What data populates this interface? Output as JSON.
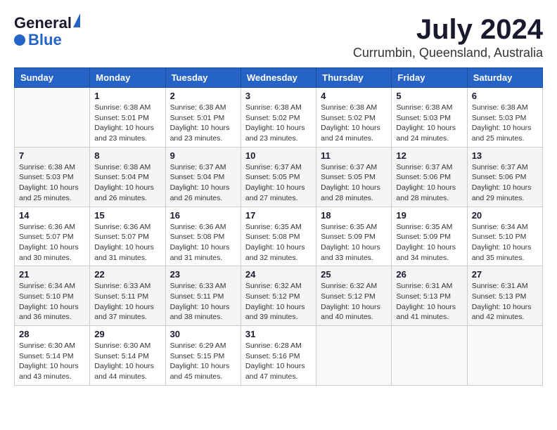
{
  "header": {
    "logo_line1": "General",
    "logo_line2": "Blue",
    "main_title": "July 2024",
    "subtitle": "Currumbin, Queensland, Australia"
  },
  "calendar": {
    "days_of_week": [
      "Sunday",
      "Monday",
      "Tuesday",
      "Wednesday",
      "Thursday",
      "Friday",
      "Saturday"
    ],
    "weeks": [
      [
        {
          "day": "",
          "info": ""
        },
        {
          "day": "1",
          "info": "Sunrise: 6:38 AM\nSunset: 5:01 PM\nDaylight: 10 hours\nand 23 minutes."
        },
        {
          "day": "2",
          "info": "Sunrise: 6:38 AM\nSunset: 5:01 PM\nDaylight: 10 hours\nand 23 minutes."
        },
        {
          "day": "3",
          "info": "Sunrise: 6:38 AM\nSunset: 5:02 PM\nDaylight: 10 hours\nand 23 minutes."
        },
        {
          "day": "4",
          "info": "Sunrise: 6:38 AM\nSunset: 5:02 PM\nDaylight: 10 hours\nand 24 minutes."
        },
        {
          "day": "5",
          "info": "Sunrise: 6:38 AM\nSunset: 5:03 PM\nDaylight: 10 hours\nand 24 minutes."
        },
        {
          "day": "6",
          "info": "Sunrise: 6:38 AM\nSunset: 5:03 PM\nDaylight: 10 hours\nand 25 minutes."
        }
      ],
      [
        {
          "day": "7",
          "info": "Sunrise: 6:38 AM\nSunset: 5:03 PM\nDaylight: 10 hours\nand 25 minutes."
        },
        {
          "day": "8",
          "info": "Sunrise: 6:38 AM\nSunset: 5:04 PM\nDaylight: 10 hours\nand 26 minutes."
        },
        {
          "day": "9",
          "info": "Sunrise: 6:37 AM\nSunset: 5:04 PM\nDaylight: 10 hours\nand 26 minutes."
        },
        {
          "day": "10",
          "info": "Sunrise: 6:37 AM\nSunset: 5:05 PM\nDaylight: 10 hours\nand 27 minutes."
        },
        {
          "day": "11",
          "info": "Sunrise: 6:37 AM\nSunset: 5:05 PM\nDaylight: 10 hours\nand 28 minutes."
        },
        {
          "day": "12",
          "info": "Sunrise: 6:37 AM\nSunset: 5:06 PM\nDaylight: 10 hours\nand 28 minutes."
        },
        {
          "day": "13",
          "info": "Sunrise: 6:37 AM\nSunset: 5:06 PM\nDaylight: 10 hours\nand 29 minutes."
        }
      ],
      [
        {
          "day": "14",
          "info": "Sunrise: 6:36 AM\nSunset: 5:07 PM\nDaylight: 10 hours\nand 30 minutes."
        },
        {
          "day": "15",
          "info": "Sunrise: 6:36 AM\nSunset: 5:07 PM\nDaylight: 10 hours\nand 31 minutes."
        },
        {
          "day": "16",
          "info": "Sunrise: 6:36 AM\nSunset: 5:08 PM\nDaylight: 10 hours\nand 31 minutes."
        },
        {
          "day": "17",
          "info": "Sunrise: 6:35 AM\nSunset: 5:08 PM\nDaylight: 10 hours\nand 32 minutes."
        },
        {
          "day": "18",
          "info": "Sunrise: 6:35 AM\nSunset: 5:09 PM\nDaylight: 10 hours\nand 33 minutes."
        },
        {
          "day": "19",
          "info": "Sunrise: 6:35 AM\nSunset: 5:09 PM\nDaylight: 10 hours\nand 34 minutes."
        },
        {
          "day": "20",
          "info": "Sunrise: 6:34 AM\nSunset: 5:10 PM\nDaylight: 10 hours\nand 35 minutes."
        }
      ],
      [
        {
          "day": "21",
          "info": "Sunrise: 6:34 AM\nSunset: 5:10 PM\nDaylight: 10 hours\nand 36 minutes."
        },
        {
          "day": "22",
          "info": "Sunrise: 6:33 AM\nSunset: 5:11 PM\nDaylight: 10 hours\nand 37 minutes."
        },
        {
          "day": "23",
          "info": "Sunrise: 6:33 AM\nSunset: 5:11 PM\nDaylight: 10 hours\nand 38 minutes."
        },
        {
          "day": "24",
          "info": "Sunrise: 6:32 AM\nSunset: 5:12 PM\nDaylight: 10 hours\nand 39 minutes."
        },
        {
          "day": "25",
          "info": "Sunrise: 6:32 AM\nSunset: 5:12 PM\nDaylight: 10 hours\nand 40 minutes."
        },
        {
          "day": "26",
          "info": "Sunrise: 6:31 AM\nSunset: 5:13 PM\nDaylight: 10 hours\nand 41 minutes."
        },
        {
          "day": "27",
          "info": "Sunrise: 6:31 AM\nSunset: 5:13 PM\nDaylight: 10 hours\nand 42 minutes."
        }
      ],
      [
        {
          "day": "28",
          "info": "Sunrise: 6:30 AM\nSunset: 5:14 PM\nDaylight: 10 hours\nand 43 minutes."
        },
        {
          "day": "29",
          "info": "Sunrise: 6:30 AM\nSunset: 5:14 PM\nDaylight: 10 hours\nand 44 minutes."
        },
        {
          "day": "30",
          "info": "Sunrise: 6:29 AM\nSunset: 5:15 PM\nDaylight: 10 hours\nand 45 minutes."
        },
        {
          "day": "31",
          "info": "Sunrise: 6:28 AM\nSunset: 5:16 PM\nDaylight: 10 hours\nand 47 minutes."
        },
        {
          "day": "",
          "info": ""
        },
        {
          "day": "",
          "info": ""
        },
        {
          "day": "",
          "info": ""
        }
      ]
    ]
  }
}
